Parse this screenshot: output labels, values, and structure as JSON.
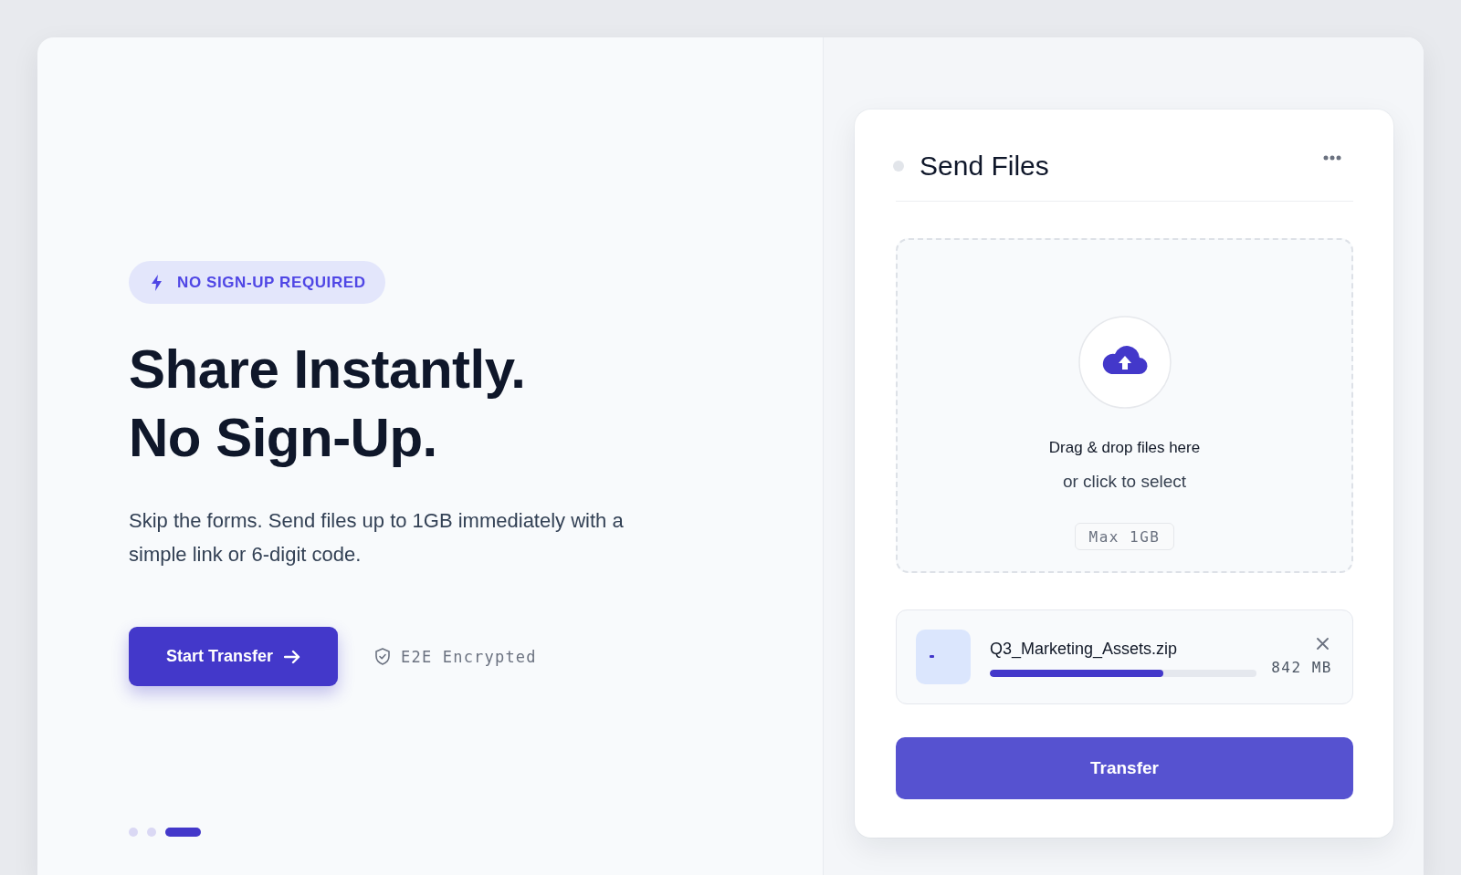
{
  "hero": {
    "badge": "NO SIGN-UP REQUIRED",
    "headline": [
      "Share Instantly.",
      "No Sign-Up."
    ],
    "description": "Skip the forms. Send files up to 1GB immediately with a simple link or 6-digit code.",
    "primary_button": "Start Transfer",
    "security_note": "E2E Encrypted"
  },
  "carousel_dots": [
    {
      "selected": false
    },
    {
      "selected": false
    },
    {
      "selected": true
    }
  ],
  "upload_card": {
    "title": "Send Files",
    "dropzone": {
      "primary_text": "Drag & drop files here",
      "secondary_text": "or click to select",
      "limit": "Max 1GB"
    },
    "files": [
      {
        "name": "Q3_Marketing_Assets.zip",
        "size": "842 MB",
        "level": 0.65
      }
    ],
    "submit_button": "Transfer"
  }
}
